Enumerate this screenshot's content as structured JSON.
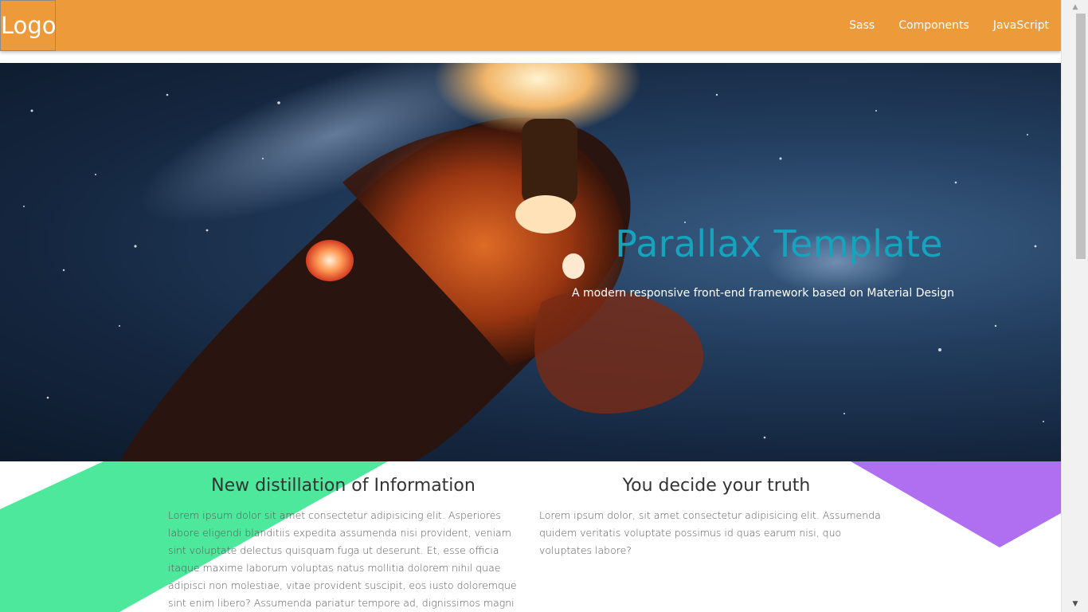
{
  "nav": {
    "logo": "Logo",
    "links": [
      {
        "label": "Sass"
      },
      {
        "label": "Components"
      },
      {
        "label": "JavaScript"
      }
    ],
    "bg_color": "#ec9a3a"
  },
  "hero": {
    "title": "Parallax Template",
    "subtitle": "A modern responsive front-end framework based on Material Design",
    "title_color": "#14a4bd"
  },
  "sections": [
    {
      "title": "New distillation of Information",
      "body": "Lorem ipsum dolor sit amet consectetur adipisicing elit. Asperiores labore eligendi blanditiis expedita assumenda nisi provident, veniam sint voluptate delectus quisquam fuga ut deserunt. Et, esse officia itaque maxime laborum voluptas natus mollitia dolorem nihil quae adipisci non molestiae, vitae provident suscipit, eos iusto doloremque sint enim libero? Assumenda pariatur tempore ad, dignissimos magni"
    },
    {
      "title": "You decide your truth",
      "body": "Lorem ipsum dolor, sit amet consectetur adipisicing elit. Assumenda quidem veritatis voluptate possimus id quas earum nisi, quo voluptates labore?"
    }
  ],
  "decor": {
    "green": "#4de89c",
    "purple": "#b06ef0"
  },
  "scrollbar": {
    "up_icon": "scroll-up-arrow",
    "down_icon": "scroll-down-arrow"
  }
}
